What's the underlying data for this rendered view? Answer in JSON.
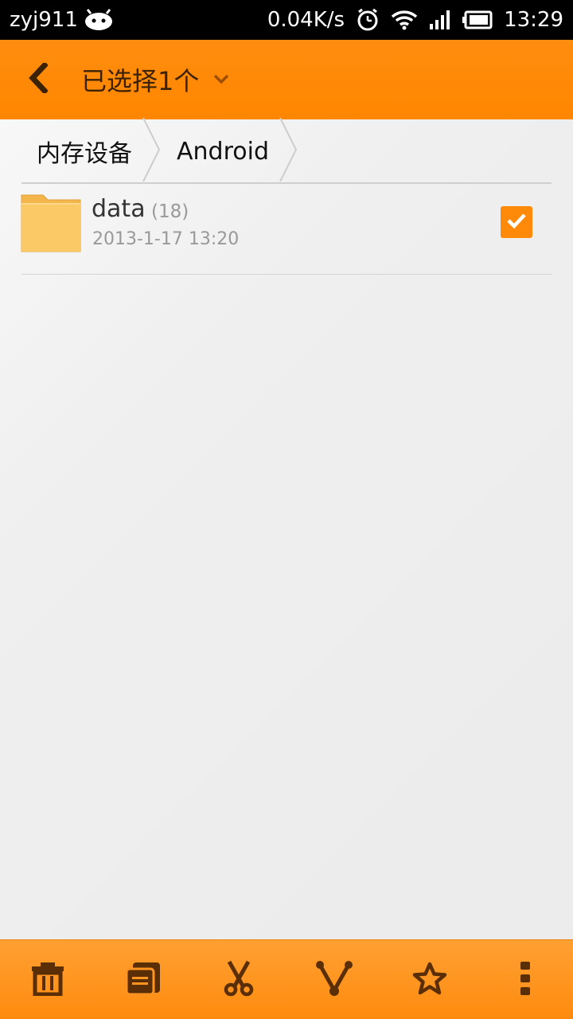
{
  "status_bar": {
    "username": "zyj911",
    "net_speed": "0.04K/s",
    "time": "13:29"
  },
  "title_bar": {
    "title": "已选择1个"
  },
  "breadcrumb": {
    "items": [
      {
        "label": "内存设备"
      },
      {
        "label": "Android"
      }
    ]
  },
  "files": [
    {
      "name": "data",
      "count": "(18)",
      "date": "2013-1-17 13:20",
      "selected": true
    }
  ],
  "bottom_toolbar": {
    "items": [
      "delete-icon",
      "copy-icon",
      "cut-icon",
      "share-icon",
      "favorite-icon",
      "more-icon"
    ]
  },
  "colors": {
    "accent": "#ff8a0a",
    "toolbar_icon": "#5a2e06"
  }
}
